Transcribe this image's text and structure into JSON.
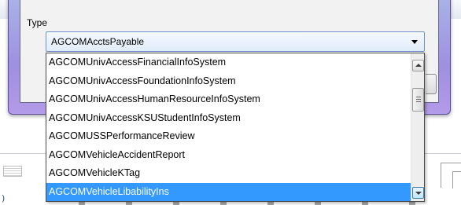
{
  "dialog": {
    "type_label": "Type",
    "combo_value": "AGCOMAcctsPayable"
  },
  "dropdown": {
    "items": [
      "AGCOMUnivAccessFinancialInfoSystem",
      "AGCOMUnivAccessFoundationInfoSystem",
      "AGCOMUnivAccessHumanResourceInfoSystem",
      "AGCOMUnivAccessKSUStudentInfoSystem",
      "AGCOMUSSPerformanceReview",
      "AGCOMVehicleAccidentReport",
      "AGCOMVehicleKTag",
      "AGCOMVehicleLibabilityIns"
    ],
    "selected_item": "AGCOMVehicleLibabilityIns"
  },
  "colors": {
    "selection": "#3399ff",
    "dialog_frame": "#a9a0e4"
  },
  "background": {
    "fragment_text": ")"
  }
}
